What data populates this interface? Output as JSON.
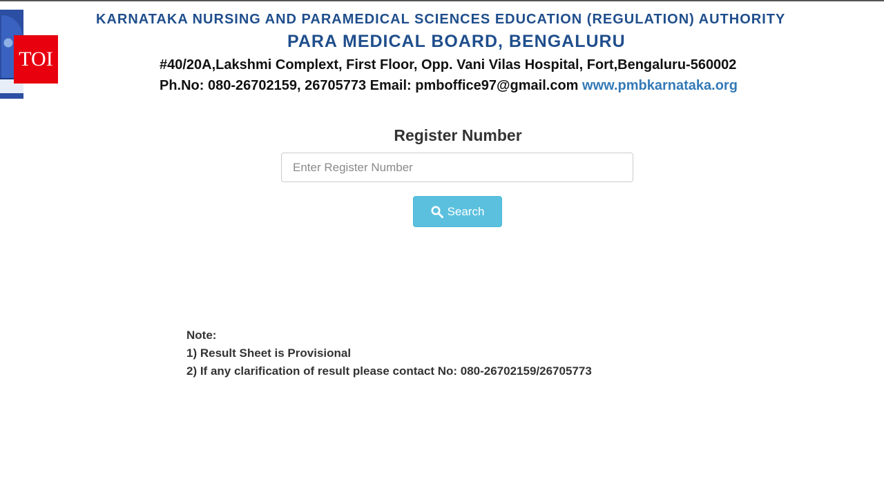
{
  "header": {
    "authority": "KARNATAKA NURSING AND PARAMEDICAL SCIENCES EDUCATION (REGULATION) AUTHORITY",
    "board": "PARA MEDICAL BOARD, BENGALURU",
    "address": "#40/20A,Lakshmi Complext, First Floor, Opp. Vani Vilas Hospital, Fort,Bengaluru-560002",
    "contact": "Ph.No: 080-26702159, 26705773 Email: pmboffice97@gmail.com",
    "website": "www.pmbkarnataka.org",
    "logo_icon": "board-emblem-icon"
  },
  "watermark": {
    "label": "TOI",
    "color": "#e8000f"
  },
  "form": {
    "label": "Register Number",
    "input_value": "",
    "input_placeholder": "Enter Register Number",
    "search_label": "Search",
    "search_icon": "search-icon",
    "button_color": "#5bc0de"
  },
  "notes": {
    "heading": "Note:",
    "items": [
      "1) Result Sheet is Provisional",
      "2) If any clarification of result please contact No: 080-26702159/26705773"
    ]
  },
  "colors": {
    "header_blue": "#1f4e8c",
    "link_blue": "#337ab7"
  }
}
